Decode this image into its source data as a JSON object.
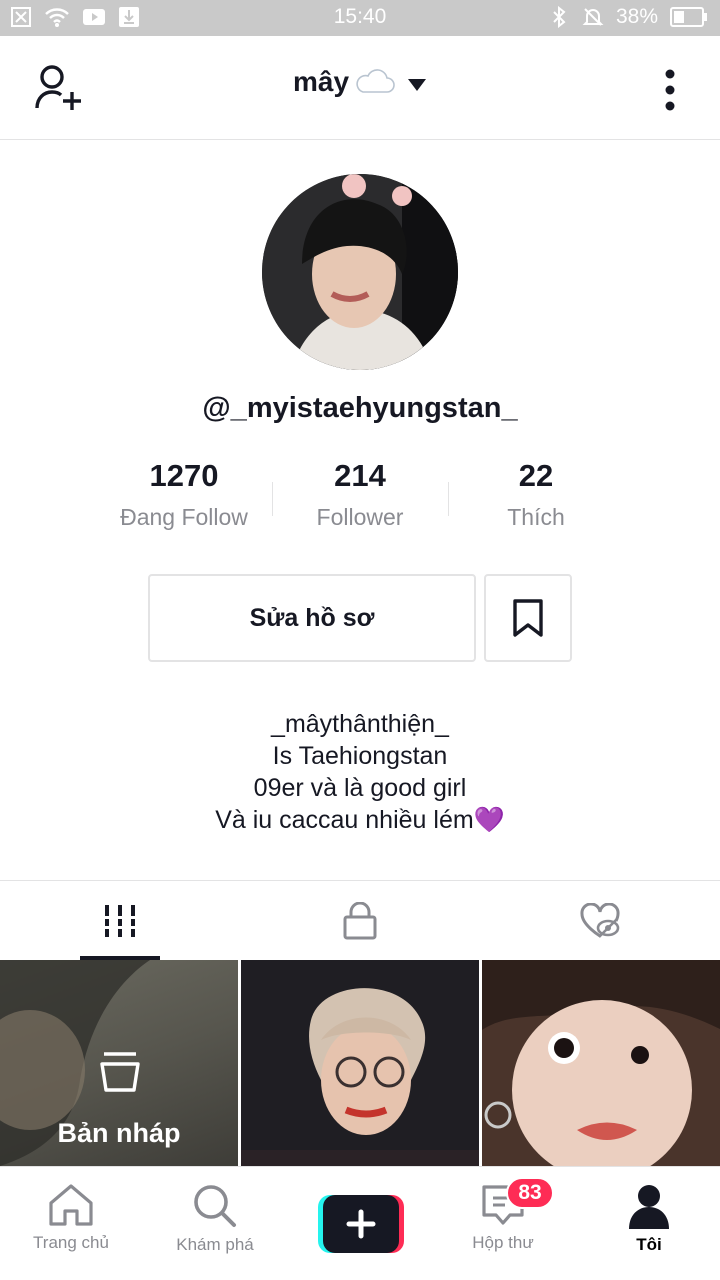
{
  "status_bar": {
    "time": "15:40",
    "battery": "38%"
  },
  "header": {
    "title": "mây",
    "title_emoji": "☁"
  },
  "profile": {
    "handle": "@_myistaehyungstan_",
    "stats": [
      {
        "value": "1270",
        "label": "Đang Follow"
      },
      {
        "value": "214",
        "label": "Follower"
      },
      {
        "value": "22",
        "label": "Thích"
      }
    ],
    "edit_label": "Sửa hồ sơ",
    "bio": [
      "_mâythânthiện_",
      "Is Taehiongstan",
      "09er và là good girl",
      "Và iu caccau nhiều lém💜"
    ]
  },
  "grid": {
    "draft_label": "Bản nháp"
  },
  "bottom_nav": {
    "home": "Trang chủ",
    "discover": "Khám phá",
    "inbox": "Hộp thư",
    "inbox_badge": "83",
    "me": "Tôi"
  },
  "colors": {
    "accent": "#fe2c55",
    "cyan": "#25f4ee",
    "text": "#161823",
    "muted": "#8a8b91"
  }
}
